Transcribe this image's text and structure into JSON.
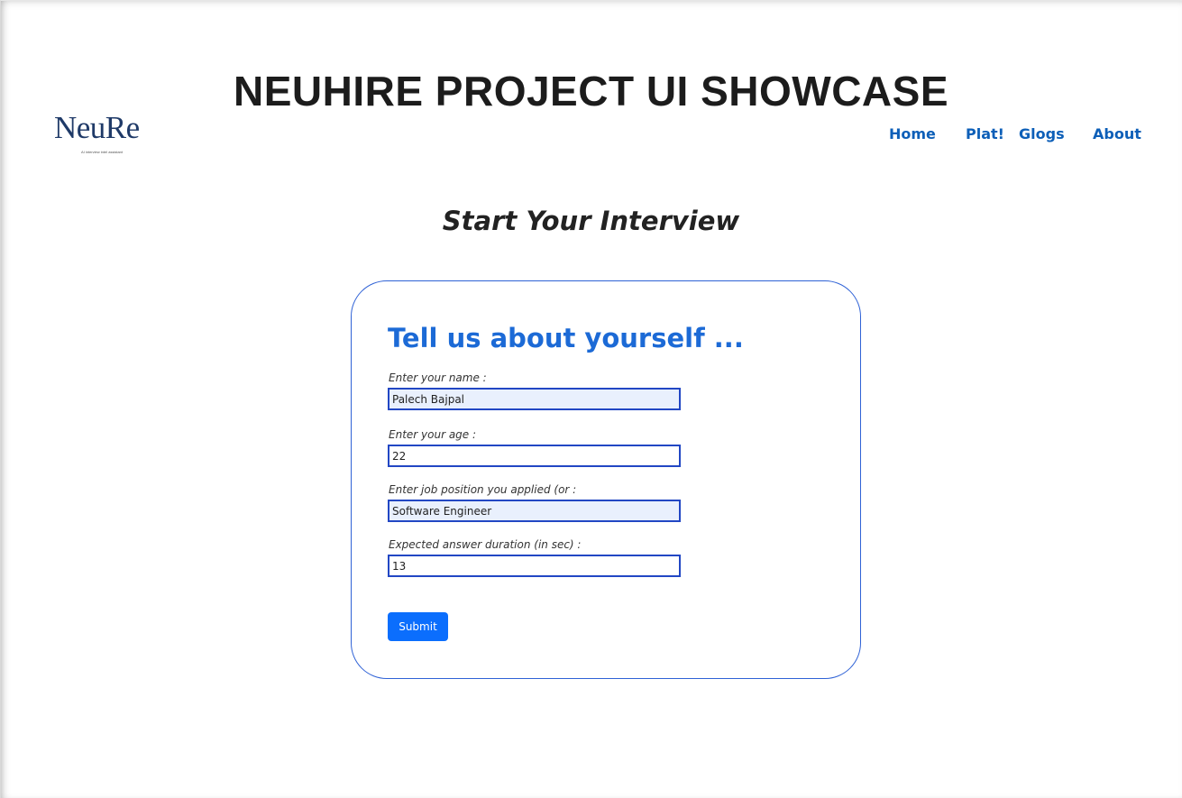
{
  "showcase_title": "NEUHIRE PROJECT UI SHOWCASE",
  "logo": {
    "text": "NeuRe",
    "tagline": "AI interview intel assistant"
  },
  "nav": {
    "items": [
      {
        "label": "Home"
      },
      {
        "label": "Plat!"
      },
      {
        "label": "Glogs"
      },
      {
        "label": "About"
      }
    ]
  },
  "page_heading": "Start Your Interview",
  "form": {
    "title": "Tell us about yourself ...",
    "fields": [
      {
        "label": "Enter your name :",
        "value": "Palech Bajpal"
      },
      {
        "label": "Enter your age :",
        "value": "22"
      },
      {
        "label": "Enter job position you applied (or :",
        "value": "Software Engineer"
      },
      {
        "label": "Expected answer duration (in sec) :",
        "value": "13"
      }
    ],
    "submit_label": "Submit"
  },
  "colors": {
    "nav_link": "#0d5fb8",
    "card_border": "#2f62d6",
    "form_title": "#1c6ad6",
    "input_border": "#2247c4",
    "autofill_background": "#e9f0fd",
    "button": "#0b6efd"
  }
}
